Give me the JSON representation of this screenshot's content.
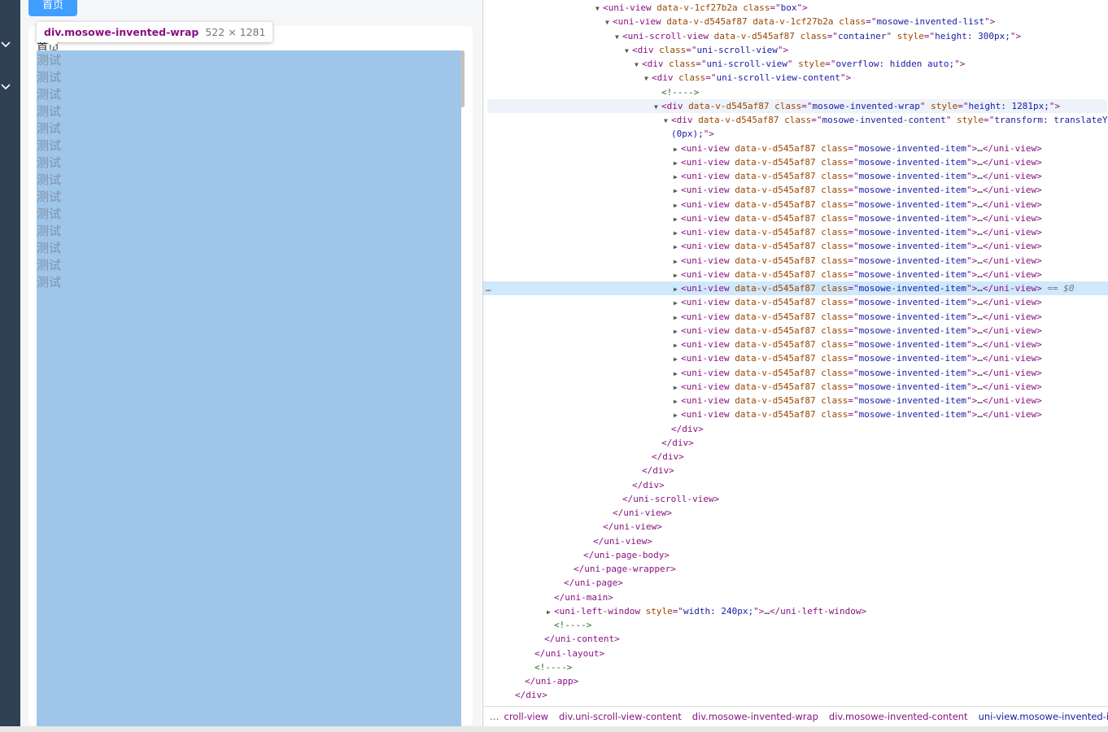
{
  "page": {
    "home_button": "首页",
    "peek_text": "首页",
    "item_text": "测试",
    "item_count": 14
  },
  "tooltip": {
    "selector": "div.mosowe-invented-wrap",
    "size": "522 × 1281"
  },
  "devtools": {
    "lines": [
      {
        "indent": 731,
        "tri": "▼",
        "parts": [
          [
            "tag",
            "<uni-view "
          ],
          [
            "an",
            "data-v-1cf27b2a "
          ],
          [
            "an",
            "class"
          ],
          [
            "tag",
            "=\""
          ],
          [
            "av",
            "box"
          ],
          [
            "tag",
            "\">"
          ]
        ]
      },
      {
        "indent": 743,
        "tri": "▼",
        "parts": [
          [
            "tag",
            "<uni-view "
          ],
          [
            "an",
            "data-v-d545af87 data-v-1cf27b2a "
          ],
          [
            "an",
            "class"
          ],
          [
            "tag",
            "=\""
          ],
          [
            "av",
            "mosowe-invented-list"
          ],
          [
            "tag",
            "\">"
          ]
        ]
      },
      {
        "indent": 755,
        "tri": "▼",
        "parts": [
          [
            "tag",
            "<uni-scroll-view "
          ],
          [
            "an",
            "data-v-d545af87 "
          ],
          [
            "an",
            "class"
          ],
          [
            "tag",
            "=\""
          ],
          [
            "av",
            "container"
          ],
          [
            "tag",
            "\" "
          ],
          [
            "an",
            "style"
          ],
          [
            "tag",
            "=\""
          ],
          [
            "av",
            "height: 300px;"
          ],
          [
            "tag",
            "\">"
          ]
        ]
      },
      {
        "indent": 767,
        "tri": "▼",
        "parts": [
          [
            "tag",
            "<div "
          ],
          [
            "an",
            "class"
          ],
          [
            "tag",
            "=\""
          ],
          [
            "av",
            "uni-scroll-view"
          ],
          [
            "tag",
            "\">"
          ]
        ]
      },
      {
        "indent": 779,
        "tri": "▼",
        "parts": [
          [
            "tag",
            "<div "
          ],
          [
            "an",
            "class"
          ],
          [
            "tag",
            "=\""
          ],
          [
            "av",
            "uni-scroll-view"
          ],
          [
            "tag",
            "\" "
          ],
          [
            "an",
            "style"
          ],
          [
            "tag",
            "=\""
          ],
          [
            "av",
            "overflow: hidden auto;"
          ],
          [
            "tag",
            "\">"
          ]
        ]
      },
      {
        "indent": 791,
        "tri": "▼",
        "parts": [
          [
            "tag",
            "<div "
          ],
          [
            "an",
            "class"
          ],
          [
            "tag",
            "=\""
          ],
          [
            "av",
            "uni-scroll-view-content"
          ],
          [
            "tag",
            "\">"
          ]
        ]
      },
      {
        "indent": 812,
        "tri": "",
        "parts": [
          [
            "cm",
            "<!---->"
          ]
        ]
      },
      {
        "indent": 803,
        "tri": "▼",
        "hl": "light",
        "parts": [
          [
            "tag",
            "<div "
          ],
          [
            "an",
            "data-v-d545af87 "
          ],
          [
            "an",
            "class"
          ],
          [
            "tag",
            "=\""
          ],
          [
            "av",
            "mosowe-invented-wrap"
          ],
          [
            "tag",
            "\" "
          ],
          [
            "an",
            "style"
          ],
          [
            "tag",
            "=\""
          ],
          [
            "av",
            "height: 1281px;"
          ],
          [
            "tag",
            "\">"
          ]
        ]
      },
      {
        "indent": 815,
        "tri": "▼",
        "parts": [
          [
            "tag",
            "<div "
          ],
          [
            "an",
            "data-v-d545af87 "
          ],
          [
            "an",
            "class"
          ],
          [
            "tag",
            "=\""
          ],
          [
            "av",
            "mosowe-invented-content"
          ],
          [
            "tag",
            "\" "
          ],
          [
            "an",
            "style"
          ],
          [
            "tag",
            "=\""
          ],
          [
            "av",
            "transform: translateY"
          ]
        ]
      },
      {
        "indent": 824,
        "tri": "",
        "parts": [
          [
            "av",
            "(0px);"
          ],
          [
            "tag",
            "\">"
          ]
        ]
      },
      {
        "indent": 827,
        "tri": "▶",
        "item": true
      },
      {
        "indent": 827,
        "tri": "▶",
        "item": true
      },
      {
        "indent": 827,
        "tri": "▶",
        "item": true
      },
      {
        "indent": 827,
        "tri": "▶",
        "item": true
      },
      {
        "indent": 827,
        "tri": "▶",
        "item": true
      },
      {
        "indent": 827,
        "tri": "▶",
        "item": true
      },
      {
        "indent": 827,
        "tri": "▶",
        "item": true
      },
      {
        "indent": 827,
        "tri": "▶",
        "item": true
      },
      {
        "indent": 827,
        "tri": "▶",
        "item": true
      },
      {
        "indent": 827,
        "tri": "▶",
        "item": true
      },
      {
        "indent": 827,
        "tri": "▶",
        "item": true,
        "hl": "sel",
        "suffix": "== $0"
      },
      {
        "indent": 827,
        "tri": "▶",
        "item": true
      },
      {
        "indent": 827,
        "tri": "▶",
        "item": true
      },
      {
        "indent": 827,
        "tri": "▶",
        "item": true
      },
      {
        "indent": 827,
        "tri": "▶",
        "item": true
      },
      {
        "indent": 827,
        "tri": "▶",
        "item": true
      },
      {
        "indent": 827,
        "tri": "▶",
        "item": true
      },
      {
        "indent": 827,
        "tri": "▶",
        "item": true
      },
      {
        "indent": 827,
        "tri": "▶",
        "item": true
      },
      {
        "indent": 827,
        "tri": "▶",
        "item": true
      },
      {
        "indent": 824,
        "tri": "",
        "parts": [
          [
            "tag",
            "</div>"
          ]
        ]
      },
      {
        "indent": 812,
        "tri": "",
        "parts": [
          [
            "tag",
            "</div>"
          ]
        ]
      },
      {
        "indent": 800,
        "tri": "",
        "parts": [
          [
            "tag",
            "</div>"
          ]
        ]
      },
      {
        "indent": 788,
        "tri": "",
        "parts": [
          [
            "tag",
            "</div>"
          ]
        ]
      },
      {
        "indent": 776,
        "tri": "",
        "parts": [
          [
            "tag",
            "</div>"
          ]
        ]
      },
      {
        "indent": 764,
        "tri": "",
        "parts": [
          [
            "tag",
            "</uni-scroll-view>"
          ]
        ]
      },
      {
        "indent": 752,
        "tri": "",
        "parts": [
          [
            "tag",
            "</uni-view>"
          ]
        ]
      },
      {
        "indent": 740,
        "tri": "",
        "parts": [
          [
            "tag",
            "</uni-view>"
          ]
        ]
      },
      {
        "indent": 728,
        "tri": "",
        "parts": [
          [
            "tag",
            "</uni-view>"
          ]
        ]
      },
      {
        "indent": 716,
        "tri": "",
        "parts": [
          [
            "tag",
            "</uni-page-body>"
          ]
        ]
      },
      {
        "indent": 704,
        "tri": "",
        "parts": [
          [
            "tag",
            "</uni-page-wrapper>"
          ]
        ]
      },
      {
        "indent": 692,
        "tri": "",
        "parts": [
          [
            "tag",
            "</uni-page>"
          ]
        ]
      },
      {
        "indent": 680,
        "tri": "",
        "parts": [
          [
            "tag",
            "</uni-main>"
          ]
        ]
      },
      {
        "indent": 671,
        "tri": "▶",
        "parts": [
          [
            "tag",
            "<uni-left-window "
          ],
          [
            "an",
            "style"
          ],
          [
            "tag",
            "=\""
          ],
          [
            "av",
            "width: 240px;"
          ],
          [
            "tag",
            "\">"
          ],
          [
            "tx",
            "…"
          ],
          [
            "tag",
            "</uni-left-window>"
          ]
        ]
      },
      {
        "indent": 680,
        "tri": "",
        "parts": [
          [
            "cm",
            "<!---->"
          ]
        ]
      },
      {
        "indent": 668,
        "tri": "",
        "parts": [
          [
            "tag",
            "</uni-content>"
          ]
        ]
      },
      {
        "indent": 656,
        "tri": "",
        "parts": [
          [
            "tag",
            "</uni-layout>"
          ]
        ]
      },
      {
        "indent": 656,
        "tri": "",
        "parts": [
          [
            "cm",
            "<!---->"
          ]
        ]
      },
      {
        "indent": 644,
        "tri": "",
        "parts": [
          [
            "tag",
            "</uni-app>"
          ]
        ]
      },
      {
        "indent": 632,
        "tri": "",
        "parts": [
          [
            "tag",
            "</div>"
          ]
        ]
      }
    ],
    "item_line": [
      [
        "tag",
        "<uni-view "
      ],
      [
        "an",
        "data-v-d545af87 "
      ],
      [
        "an",
        "class"
      ],
      [
        "tag",
        "=\""
      ],
      [
        "av",
        "mosowe-invented-item"
      ],
      [
        "tag",
        "\">"
      ],
      [
        "tx",
        "…"
      ],
      [
        "tag",
        "</uni-view>"
      ]
    ],
    "breadcrumbs": [
      "…",
      "croll-view",
      "div.uni-scroll-view-content",
      "div.mosowe-invented-wrap",
      "div.mosowe-invented-content",
      "uni-view.mosowe-invented-item"
    ]
  }
}
